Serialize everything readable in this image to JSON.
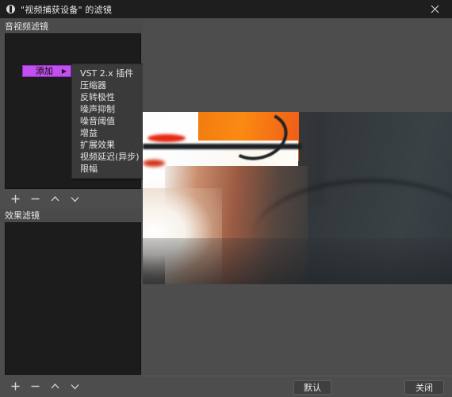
{
  "window": {
    "title": "\"视频捕获设备\" 的滤镜",
    "app_icon": "obs-logo-icon",
    "close_icon": "close-icon"
  },
  "sections": {
    "av_filters": {
      "header": "音视频滤镜",
      "items": []
    },
    "effect_filters": {
      "header": "效果滤镜",
      "items": []
    }
  },
  "toolbar": {
    "add_icon": "plus-icon",
    "remove_icon": "minus-icon",
    "move_up_icon": "chevron-up-icon",
    "move_down_icon": "chevron-down-icon"
  },
  "add_menu": {
    "button_label": "添加",
    "submenu_arrow": "▶",
    "items": [
      "VST 2.x 插件",
      "压缩器",
      "反转极性",
      "噪声抑制",
      "噪音阈值",
      "增益",
      "扩展效果",
      "视频延迟(异步)",
      "限幅"
    ]
  },
  "preview": {
    "label": "video-preview"
  },
  "footer": {
    "default_label": "默认",
    "close_label": "关闭"
  },
  "colors": {
    "accent": "#c24ff0",
    "titlebar": "#1e1e1e",
    "window_bg": "#4d4d4d",
    "list_bg": "#1c1c1c",
    "menu_bg": "#3a3a3a"
  }
}
